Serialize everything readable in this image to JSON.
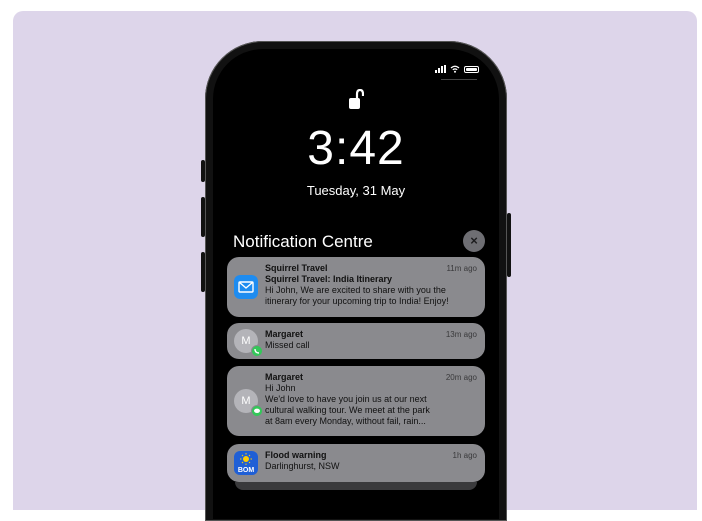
{
  "status": {
    "signal_icon": "signal-bars-icon",
    "wifi_icon": "wifi-icon",
    "battery_icon": "battery-icon"
  },
  "lock": {
    "icon": "unlocked-padlock-icon"
  },
  "time": "3:42",
  "date": "Tuesday, 31 May",
  "notification_centre": {
    "title": "Notification Centre",
    "close_icon": "close-icon",
    "close_glyph": "×"
  },
  "notifications": [
    {
      "sender": "Squirrel Travel",
      "ago": "11m ago",
      "subject": "Squirrel Travel: India Itinerary",
      "body_1": "Hi John, We are excited to share with you the",
      "body_2": "itinerary for your upcoming trip to India! Enjoy!",
      "icon": "mail-icon"
    },
    {
      "sender": "Margaret",
      "ago": "13m ago",
      "body_1": "Missed call",
      "avatar_initial": "M",
      "badge_icon": "phone-icon"
    },
    {
      "sender": "Margaret",
      "ago": "20m ago",
      "subject": "Hi John",
      "body_1": "We'd love to have you join us at our next",
      "body_2": "cultural walking tour. We meet at the park",
      "body_3": "at 8am every Monday, without fail, rain...",
      "avatar_initial": "M",
      "badge_icon": "messages-icon"
    },
    {
      "sender": "Flood warning",
      "ago": "1h ago",
      "body_1": "Darlinghurst, NSW",
      "icon": "weather-sun-icon",
      "icon_label": "BOM"
    }
  ],
  "colors": {
    "background": "#ddd5ea",
    "card": "#8a8a8e",
    "mail_blue": "#1e8cf0",
    "bom_blue": "#1f5fd6",
    "badge_green": "#34c759"
  }
}
